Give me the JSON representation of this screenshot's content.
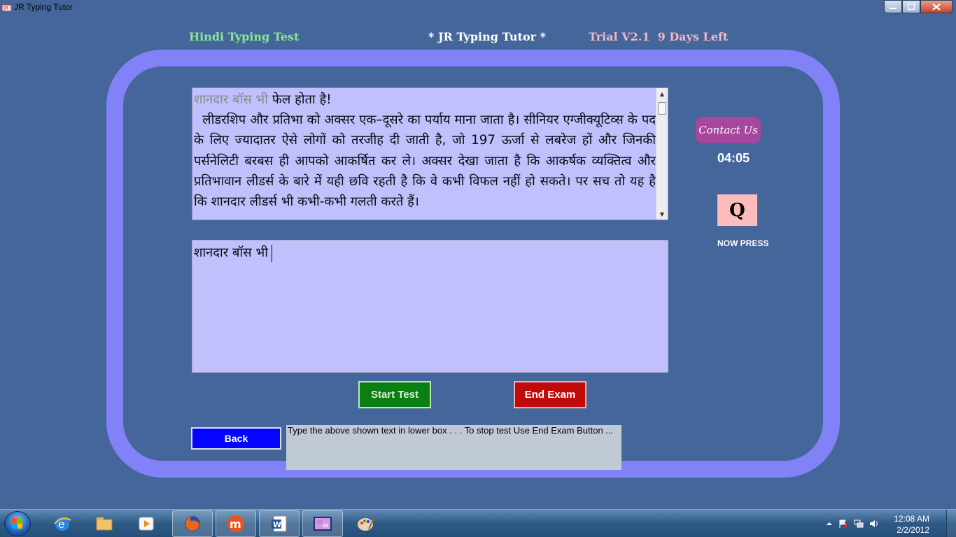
{
  "window": {
    "title": "JR Typing Tutor",
    "minimize_icon": "minimize-icon",
    "maximize_icon": "maximize-icon",
    "close_icon": "close-icon"
  },
  "header": {
    "test_name": "Hindi Typing Test",
    "app_name": "* JR Typing Tutor *",
    "trial": "Trial V2.1  9 Days Left"
  },
  "source": {
    "typed": "शानदार बॉस भी",
    "remaining": " फेल होता है!\n  लीडरशिप और प्रतिभा को अक्सर एक–दूसरे का पर्याय माना जाता है। सीनियर एग्जीक्यूटिव्स के पद के लिए ज्यादातर ऐसे लोगों को तरजीह दी जाती है, जो 197 ऊर्जा से लबरेज हों और जिनकी पर्सनेलिटी बरबस ही आपको आकर्षित कर ले। अक्सर देखा जाता है कि आकर्षक व्यक्तित्व और प्रतिभावान लीडर्स के बारे में यही छवि रहती है कि वे कभी विफल नहीं हो सकते। पर सच तो यह है कि शानदार लीडर्स भी कभी-कभी गलती करते हैं।"
  },
  "typing": {
    "value": "शानदार बॉस भी"
  },
  "buttons": {
    "start": "Start Test",
    "end": "End Exam",
    "back": "Back",
    "contact": "Contact Us"
  },
  "instruction": "Type the above shown text in lower box . . . To stop test Use End Exam Button ...",
  "timer": "04:05",
  "next_key": "Q",
  "now_press": "NOW PRESS",
  "taskbar": {
    "items": [
      {
        "icon": "ie-icon"
      },
      {
        "icon": "explorer-icon"
      },
      {
        "icon": "media-player-icon"
      },
      {
        "icon": "firefox-icon"
      },
      {
        "icon": "m-app-icon"
      },
      {
        "icon": "word-icon"
      },
      {
        "icon": "typing-tutor-icon"
      },
      {
        "icon": "paint-icon"
      }
    ],
    "clock_time": "12:08 AM",
    "clock_date": "2/2/2012"
  }
}
